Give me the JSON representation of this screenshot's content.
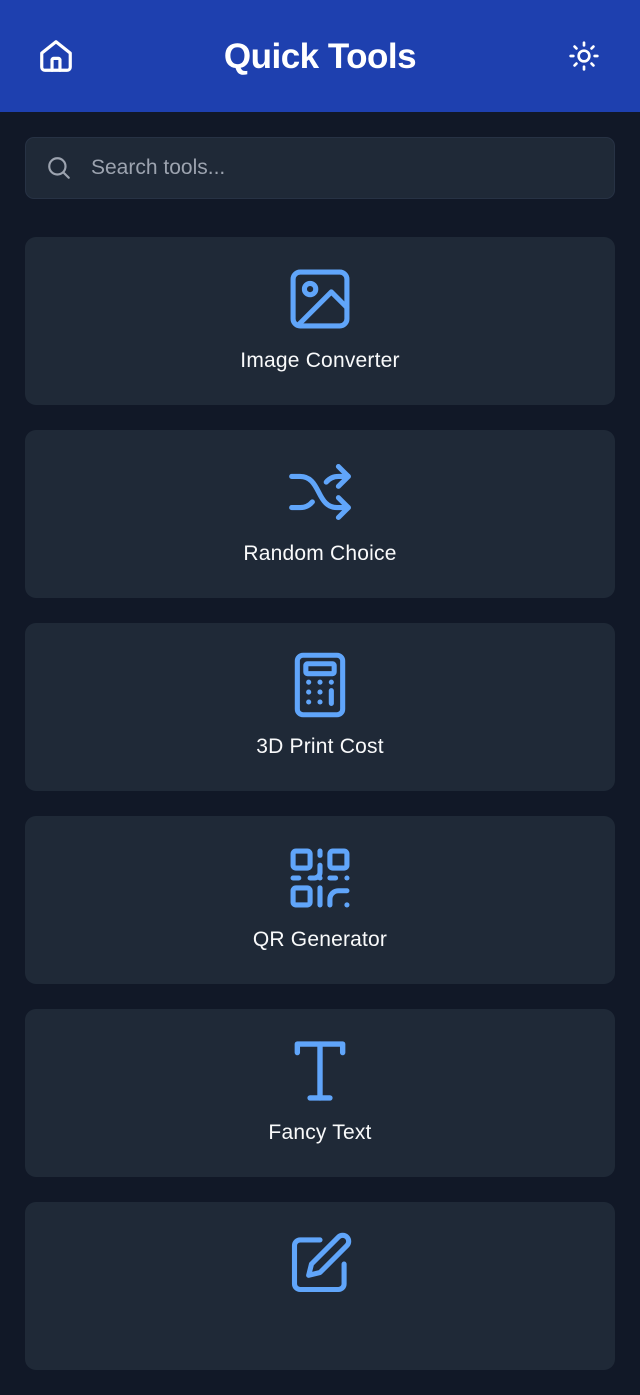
{
  "header": {
    "title": "Quick Tools",
    "home_icon": "home-icon",
    "theme_icon": "sun-icon",
    "background": "#1e40af"
  },
  "search": {
    "placeholder": "Search tools...",
    "value": "",
    "icon": "search-icon"
  },
  "colors": {
    "page_background": "#111827",
    "card_background": "#1f2937",
    "icon_accent": "#60a5fa",
    "text": "#f9fafb"
  },
  "tools": [
    {
      "label": "Image Converter",
      "icon": "image-icon"
    },
    {
      "label": "Random Choice",
      "icon": "shuffle-icon"
    },
    {
      "label": "3D Print Cost",
      "icon": "calculator-icon"
    },
    {
      "label": "QR Generator",
      "icon": "qr-code-icon"
    },
    {
      "label": "Fancy Text",
      "icon": "text-icon"
    },
    {
      "label": "",
      "icon": "edit-icon"
    }
  ]
}
